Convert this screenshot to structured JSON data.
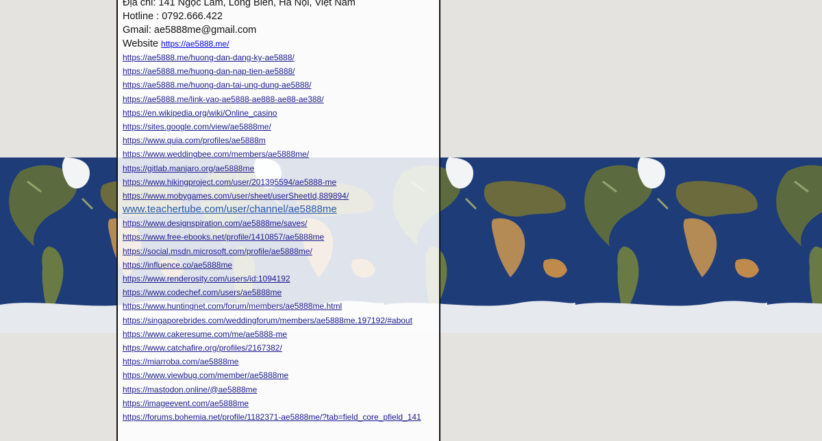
{
  "contact": {
    "address": "Địa chỉ: 141 Ngọc Lâm, Long Biên, Hà Nội, Việt Nam",
    "hotline": "Hotline : 0792.666.422",
    "gmail": "Gmail: ae5888me@gmail.com",
    "website_label": "Website",
    "website_url": "https://ae5888.me/"
  },
  "links": [
    "https://ae5888.me/huong-dan-dang-ky-ae5888/",
    "https://ae5888.me/huong-dan-nap-tien-ae5888/",
    "https://ae5888.me/huong-dan-tai-ung-dung-ae5888/",
    "https://ae5888.me/link-vao-ae5888-ae888-ae88-ae388/",
    "https://en.wikipedia.org/wiki/Online_casino",
    "https://sites.google.com/view/ae5888me/",
    "https://www.quia.com/profiles/ae5888m",
    "https://www.weddingbee.com/members/ae5888me/",
    "https://gitlab.manjaro.org/ae5888me",
    "https://www.hikingproject.com/user/201395594/ae5888-me",
    "https://www.mobygames.com/user/sheet/userSheetId,889894/",
    "www.teachertube.com/user/channel/ae5888me",
    "https://www.designspiration.com/ae5888me/saves/",
    "https://www.free-ebooks.net/profile/1410857/ae5888me",
    "https://social.msdn.microsoft.com/profile/ae5888me/",
    "https://influence.co/ae5888me",
    "https://www.renderosity.com/users/id:1094192",
    "https://www.codechef.com/users/ae5888me",
    "https://www.huntingnet.com/forum/members/ae5888me.html",
    "https://singaporebrides.com/weddingforum/members/ae5888me.197192/#about",
    "https://www.cakeresume.com/me/ae5888-me",
    "https://www.catchafire.org/profiles/2167382/",
    "https://miarroba.com/ae5888me",
    "https://www.viewbug.com/member/ae5888me",
    "https://mastodon.online/@ae5888me",
    "https://imageevent.com/ae5888me",
    "https://forums.bohemia.net/profile/1182371-ae5888me/?tab=field_core_pfield_141"
  ]
}
